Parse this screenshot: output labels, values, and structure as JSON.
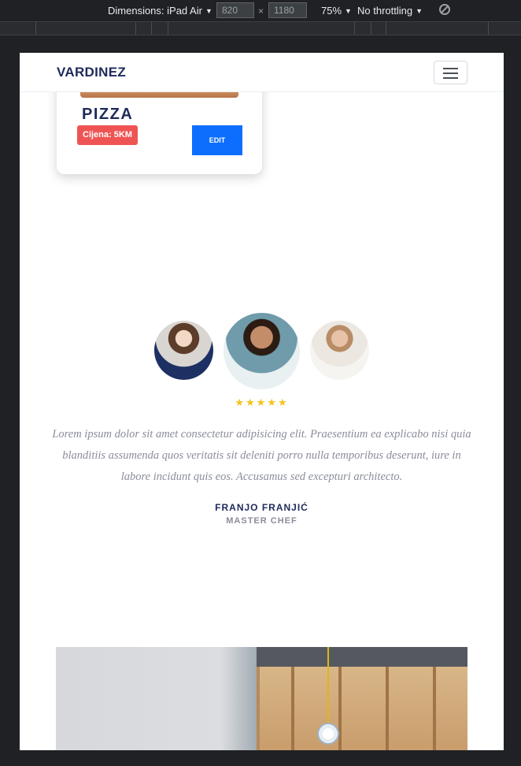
{
  "devtools": {
    "dimensions_label": "Dimensions: iPad Air",
    "width_value": "820",
    "times_symbol": "×",
    "height_value": "1180",
    "zoom": "75%",
    "throttling": "No throttling"
  },
  "navbar": {
    "brand": "VARDINEZ"
  },
  "menu_card": {
    "title": "PIZZA",
    "price": "Cijena: 5KM",
    "edit_label": "EDIT"
  },
  "testimonial": {
    "stars": "★★★★★",
    "rating": 5,
    "quote": "Lorem ipsum dolor sit amet consectetur adipisicing elit. Praesentium ea explicabo nisi quia blanditiis assumenda quos veritatis sit deleniti porro nulla temporibus deserunt, iure in labore incidunt quis eos. Accusamus sed excepturi architecto.",
    "name": "FRANJO FRANJIĆ",
    "role": "MASTER CHEF"
  },
  "colors": {
    "brand": "#1e2a5a",
    "price_badge": "#ef5454",
    "edit_button": "#0d6efd",
    "stars": "#f7c21b",
    "muted_text": "#8a8d9b"
  }
}
